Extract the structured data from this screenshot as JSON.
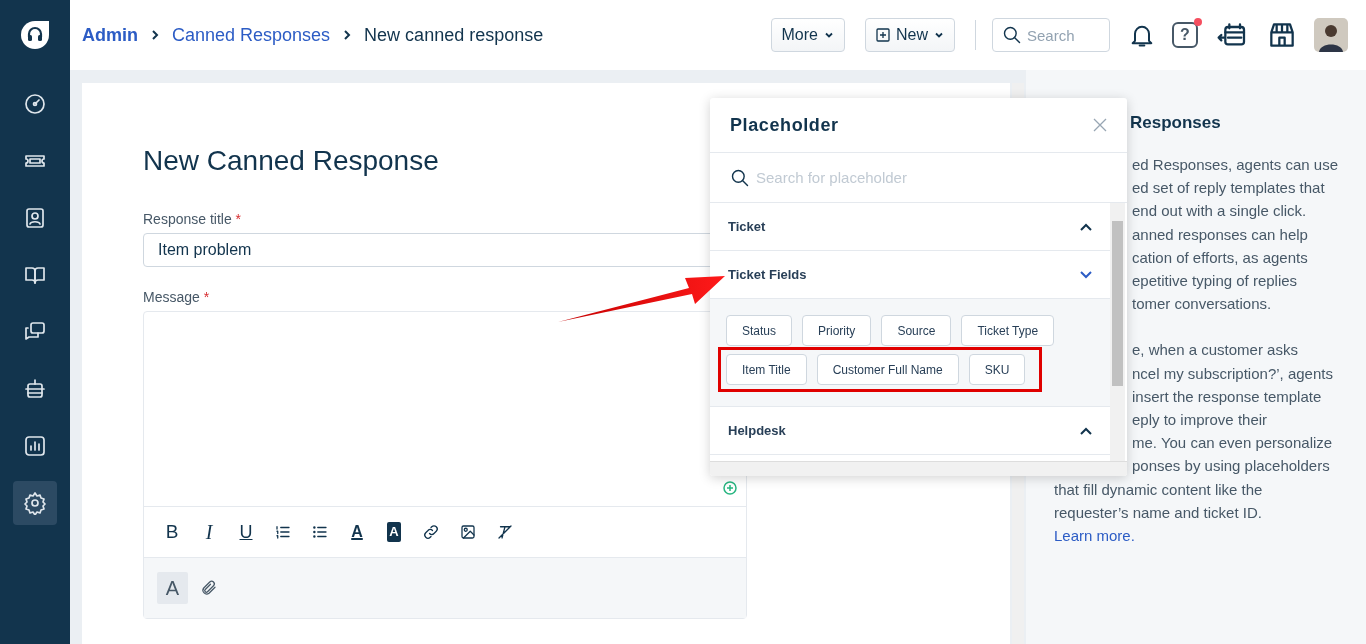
{
  "sidebar": {
    "items": [
      {
        "kind": "gauge",
        "selected": false
      },
      {
        "kind": "ticket",
        "selected": false
      },
      {
        "kind": "contact",
        "selected": false
      },
      {
        "kind": "book",
        "selected": false
      },
      {
        "kind": "chat",
        "selected": false
      },
      {
        "kind": "robot",
        "selected": false
      },
      {
        "kind": "chart",
        "selected": false
      },
      {
        "kind": "gear",
        "selected": true
      }
    ]
  },
  "topbar": {
    "breadcrumbs": [
      {
        "label": "Admin",
        "kind": "root"
      },
      {
        "label": "Canned Responses",
        "kind": "link"
      },
      {
        "label": "New canned response",
        "kind": "current"
      }
    ],
    "more_button": "More",
    "new_button": "New",
    "search": {
      "placeholder": "Search"
    },
    "help_text": "?",
    "help_notification": true
  },
  "form": {
    "title": "New Canned Response",
    "title_field": {
      "label": "Response title",
      "required_mark": "*",
      "value": "Item problem"
    },
    "message": {
      "label": "Message",
      "required_mark": "*"
    },
    "toolbar": [
      {
        "kind": "bold",
        "text": "B"
      },
      {
        "kind": "italic",
        "text": "I"
      },
      {
        "kind": "underline",
        "text": "U"
      },
      {
        "kind": "ordered-list"
      },
      {
        "kind": "bullet-list"
      },
      {
        "kind": "text-color",
        "text": "A"
      },
      {
        "kind": "highlight",
        "text": "A"
      },
      {
        "kind": "link"
      },
      {
        "kind": "image"
      },
      {
        "kind": "clear-format"
      }
    ],
    "footer": [
      {
        "kind": "font",
        "text": "A"
      },
      {
        "kind": "attach"
      }
    ]
  },
  "placeholder_panel": {
    "title": "Placeholder",
    "search": {
      "placeholder": "Search for placeholder"
    },
    "sections": [
      {
        "label": "Ticket",
        "expanded": false
      },
      {
        "label": "Ticket Fields",
        "expanded": true,
        "chip_groups": [
          {
            "annotated": false,
            "chips": [
              "Status",
              "Priority",
              "Source",
              "Ticket Type"
            ]
          },
          {
            "annotated": true,
            "chips": [
              "Item Title",
              "Customer Full Name",
              "SKU"
            ]
          }
        ]
      },
      {
        "label": "Helpdesk",
        "expanded": false
      }
    ]
  },
  "help_panel": {
    "title": "Responses",
    "lines": [
      {
        "text": "ed Responses, agents can use",
        "covered": true
      },
      {
        "text": "ed set of reply templates that",
        "covered": true
      },
      {
        "text": "end out with a single click.",
        "covered": true
      },
      {
        "text": "anned responses can help",
        "covered": true
      },
      {
        "text": "cation of efforts, as agents",
        "covered": true
      },
      {
        "text": "epetitive typing of replies",
        "covered": true
      },
      {
        "text": "tomer conversations.",
        "covered": true
      },
      {
        "text": "e, when a customer asks",
        "covered": true,
        "gap": true
      },
      {
        "text": "ncel my subscription?’, agents",
        "covered": true
      },
      {
        "text": "insert the response template",
        "covered": true
      },
      {
        "text": "eply to improve their",
        "covered": true
      },
      {
        "text": "me. You can even personalize",
        "covered": true
      },
      {
        "text": "ponses by using placeholders",
        "covered": true
      },
      {
        "text": "that fill dynamic content like the",
        "covered": false
      },
      {
        "text": "requester’s name and ticket ID.",
        "covered": false
      }
    ],
    "link": "Learn more."
  }
}
